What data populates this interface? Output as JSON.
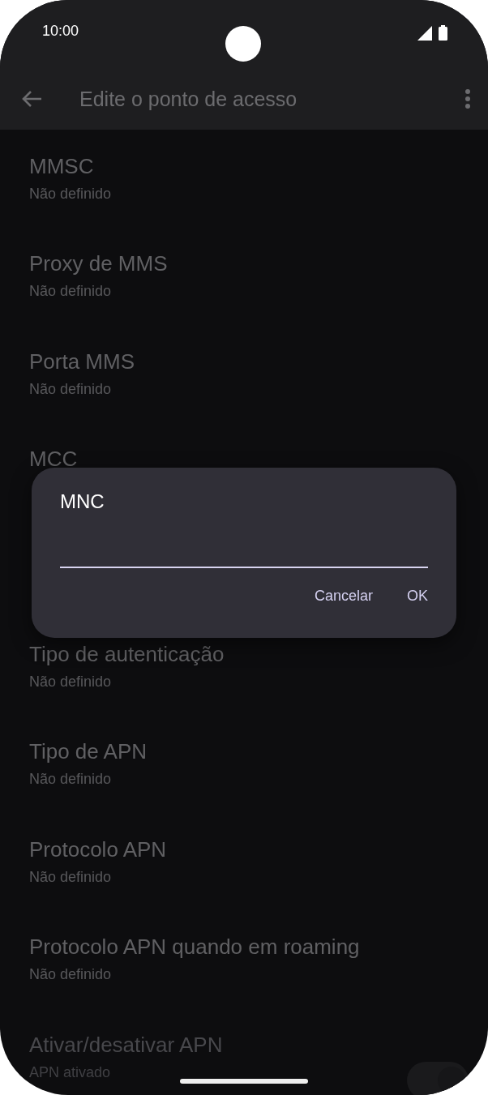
{
  "status_bar": {
    "time": "10:00"
  },
  "app_bar": {
    "title": "Edite o ponto de acesso"
  },
  "settings": [
    {
      "kind": "text",
      "title": "MMSC",
      "summary": "Não definido",
      "disabled": false
    },
    {
      "kind": "text",
      "title": "Proxy de MMS",
      "summary": "Não definido",
      "disabled": false
    },
    {
      "kind": "text",
      "title": "Porta MMS",
      "summary": "Não definido",
      "disabled": false
    },
    {
      "kind": "text",
      "title": "MCC",
      "disabled": false
    },
    {
      "kind": "covered"
    },
    {
      "kind": "text",
      "title": "Tipo de autenticação",
      "summary": "Não definido",
      "disabled": false
    },
    {
      "kind": "text",
      "title": "Tipo de APN",
      "summary": "Não definido",
      "disabled": false
    },
    {
      "kind": "text",
      "title": "Protocolo APN",
      "summary": "Não definido",
      "disabled": false
    },
    {
      "kind": "text",
      "title": "Protocolo APN quando em roaming",
      "summary": "Não definido",
      "disabled": false
    },
    {
      "kind": "switch",
      "title": "Ativar/desativar APN",
      "summary": "APN ativado",
      "disabled": true,
      "on": true
    }
  ],
  "dialog": {
    "title": "MNC",
    "buttons": [
      "Cancelar",
      "OK"
    ]
  }
}
